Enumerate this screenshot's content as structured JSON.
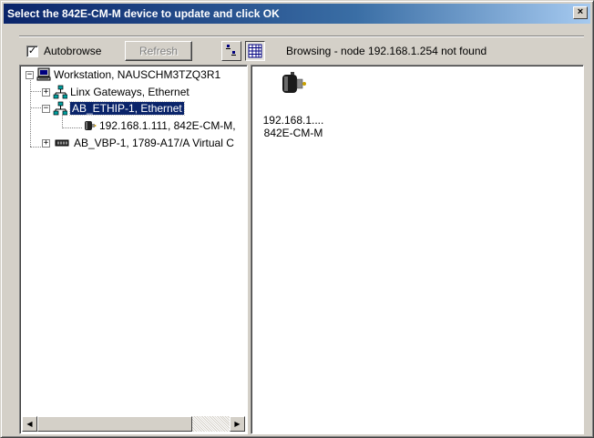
{
  "window": {
    "title": "Select the 842E-CM-M device to update and click OK",
    "close_glyph": "×"
  },
  "toolbar": {
    "autobrowse_label": "Autobrowse",
    "autobrowse_checked": true,
    "autobrowse_check_glyph": "✓",
    "refresh_label": "Refresh",
    "status": "Browsing - node 192.168.1.254 not found",
    "view_icons_icon": "large-icons-view-icon",
    "view_details_icon": "details-view-icon"
  },
  "tree": {
    "items": [
      {
        "label": "Workstation, NAUSCHM3TZQ3R1",
        "icon": "workstation-icon",
        "expander": "−",
        "depth": 0
      },
      {
        "label": "Linx Gateways, Ethernet",
        "icon": "network-icon",
        "expander": "+",
        "depth": 1
      },
      {
        "label": "AB_ETHIP-1, Ethernet",
        "icon": "network-icon",
        "expander": "−",
        "depth": 1,
        "selected": true
      },
      {
        "label": "192.168.1.111, 842E-CM-M,",
        "icon": "encoder-device-icon",
        "expander": "",
        "depth": 2
      },
      {
        "label": "AB_VBP-1, 1789-A17/A Virtual C",
        "icon": "backplane-icon",
        "expander": "+",
        "depth": 1
      }
    ],
    "scroll_left_glyph": "◀",
    "scroll_right_glyph": "▶"
  },
  "list": {
    "device": {
      "icon": "encoder-device-icon",
      "line1": "192.168.1....",
      "line2": "842E-CM-M"
    }
  },
  "colors": {
    "title_bar": "#0a246a",
    "selection": "#0a246a",
    "window_face": "#d4d0c8"
  }
}
